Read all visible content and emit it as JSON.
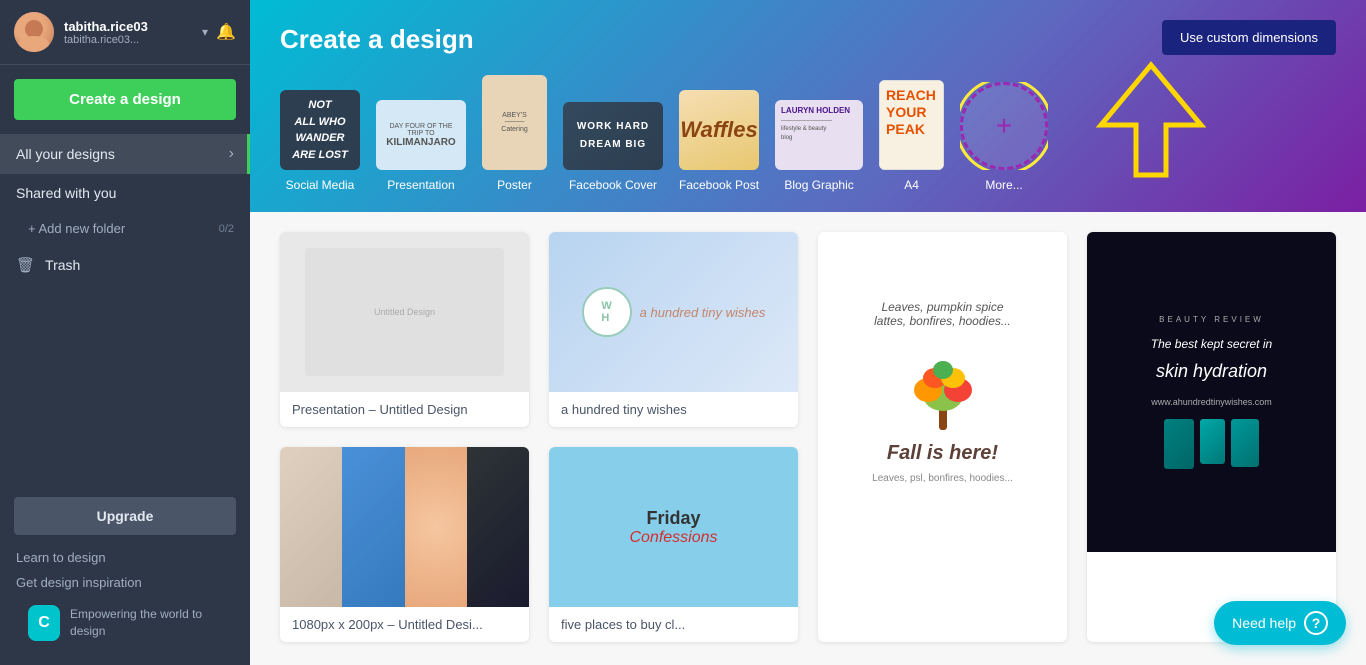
{
  "sidebar": {
    "user": {
      "name": "tabitha.rice03",
      "email": "tabitha.rice03...",
      "avatar_alt": "user avatar"
    },
    "create_button": "Create a design",
    "nav": [
      {
        "id": "all-designs",
        "label": "All your designs",
        "active": true,
        "has_arrow": true
      },
      {
        "id": "shared",
        "label": "Shared with you",
        "active": false
      }
    ],
    "folder": {
      "label": "+ Add new folder",
      "badge": "0/2"
    },
    "trash": {
      "label": "Trash"
    },
    "upgrade_btn": "Upgrade",
    "links": [
      {
        "id": "learn",
        "label": "Learn to design"
      },
      {
        "id": "inspiration",
        "label": "Get design inspiration"
      }
    ],
    "brand": {
      "logo": "C",
      "tagline": "Empowering the world to design"
    }
  },
  "hero": {
    "title": "Create a design",
    "custom_btn": "Use custom dimensions",
    "design_types": [
      {
        "id": "social-media",
        "label": "Social Media",
        "thumb_type": "social"
      },
      {
        "id": "presentation",
        "label": "Presentation",
        "thumb_type": "presentation"
      },
      {
        "id": "poster",
        "label": "Poster",
        "thumb_type": "poster"
      },
      {
        "id": "facebook-cover",
        "label": "Facebook Cover",
        "thumb_type": "facebook-cover"
      },
      {
        "id": "facebook-post",
        "label": "Facebook Post",
        "thumb_type": "facebook-post"
      },
      {
        "id": "blog-graphic",
        "label": "Blog Graphic",
        "thumb_type": "blog-graphic"
      },
      {
        "id": "a4",
        "label": "A4",
        "thumb_type": "a4"
      },
      {
        "id": "more",
        "label": "More...",
        "thumb_type": "more"
      }
    ]
  },
  "designs": [
    {
      "id": "presentation-untitled",
      "type": "presentation",
      "label": "Presentation – Untitled Design",
      "thumb": "presentation"
    },
    {
      "id": "hundred-tiny-wishes",
      "type": "social",
      "label": "a hundred tiny wishes",
      "thumb": "wishes"
    },
    {
      "id": "fall-leaves",
      "type": "facebook-post",
      "label": "Leaves, psl, bonfires, hoodies...",
      "thumb": "fall"
    },
    {
      "id": "beauty-review",
      "type": "blog-graphic",
      "label": "",
      "thumb": "beauty"
    },
    {
      "id": "untitled-banner",
      "type": "banner",
      "label": "1080px x 200px – Untitled Desi...",
      "thumb": "banner"
    },
    {
      "id": "friday-confessions",
      "type": "social",
      "label": "five places to buy cl...",
      "thumb": "friday"
    }
  ],
  "help": {
    "label": "Need help",
    "icon": "?"
  }
}
